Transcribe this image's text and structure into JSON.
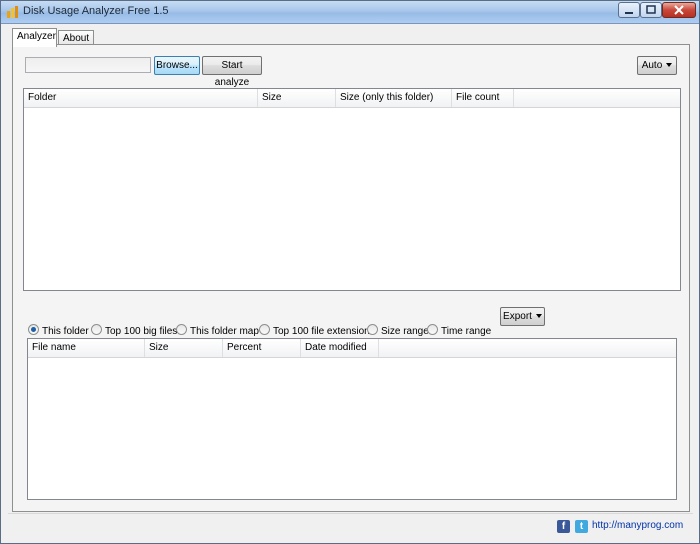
{
  "window": {
    "title": "Disk Usage Analyzer Free 1.5"
  },
  "tabs": [
    {
      "label": "Analyzer",
      "active": true
    },
    {
      "label": "About",
      "active": false
    }
  ],
  "toolbar": {
    "path_value": "",
    "browse_label": "Browse...",
    "start_label": "Start analyze",
    "auto_label": "Auto"
  },
  "folder_list": {
    "columns": [
      "Folder",
      "Size",
      "Size (only this folder)",
      "File count"
    ],
    "rows": []
  },
  "view_options": {
    "radios": [
      {
        "label": "This folder",
        "checked": true
      },
      {
        "label": "Top 100 big files",
        "checked": false
      },
      {
        "label": "This folder map",
        "checked": false
      },
      {
        "label": "Top 100 file extension",
        "checked": false
      },
      {
        "label": "Size range",
        "checked": false
      },
      {
        "label": "Time range",
        "checked": false
      }
    ],
    "export_label": "Export"
  },
  "file_list": {
    "columns": [
      "File name",
      "Size",
      "Percent",
      "Date modified"
    ],
    "rows": []
  },
  "statusbar": {
    "facebook_icon": "facebook-icon",
    "twitter_icon": "twitter-icon",
    "link_text": "http://manyprog.com",
    "link_color": "#0033aa"
  }
}
